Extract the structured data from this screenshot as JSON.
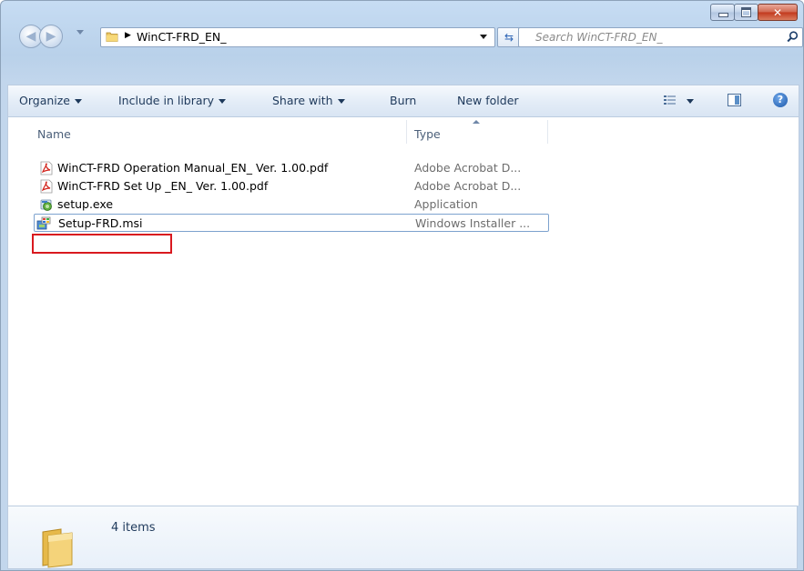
{
  "window": {
    "caption_buttons": {
      "minimize": "minimize",
      "maximize": "maximize",
      "close": "close"
    }
  },
  "address_bar": {
    "path": "WinCT-FRD_EN_",
    "search_placeholder": "Search WinCT-FRD_EN_"
  },
  "toolbar": {
    "organize": "Organize",
    "include_in_library": "Include in library",
    "share_with": "Share with",
    "burn": "Burn",
    "new_folder": "New folder"
  },
  "columns": {
    "name": "Name",
    "type": "Type"
  },
  "files": [
    {
      "name": "WinCT-FRD Operation Manual_EN_ Ver. 1.00.pdf",
      "type": "Adobe Acrobat D...",
      "icon": "pdf-icon"
    },
    {
      "name": "WinCT-FRD Set Up _EN_ Ver. 1.00.pdf",
      "type": "Adobe Acrobat D...",
      "icon": "pdf-icon"
    },
    {
      "name": "setup.exe",
      "type": "Application",
      "icon": "setup-exe-icon"
    },
    {
      "name": "Setup-FRD.msi",
      "type": "Windows Installer ...",
      "icon": "msi-installer-icon"
    }
  ],
  "details_pane": {
    "item_count": "4 items"
  },
  "colors": {
    "highlight": "#d9191f",
    "chrome": "#c6dcf3"
  }
}
